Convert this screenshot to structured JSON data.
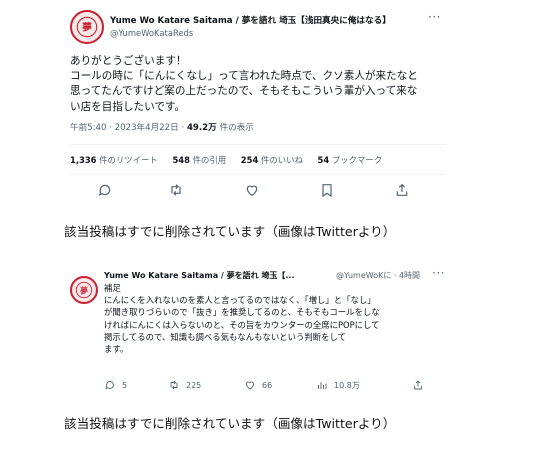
{
  "tweet1": {
    "display_name": "Yume Wo Katare Saitama / 夢を語れ 埼玉【浅田真央に俺はなる】",
    "handle": "@YumeWoKataReds",
    "more": "···",
    "body_lines": [
      "ありがとうございます！",
      "コールの時に「にんにくなし」って言われた時点で、クソ素人が来たなと",
      "思ってたんですけど案の上だったので、そもそもこういう輩が入って来な",
      "い店を目指したいです。"
    ],
    "meta_time": "午前5:40 · 2023年4月22日 · ",
    "meta_views_number": "49.2万",
    "meta_views_label": " 件の表示",
    "stats": {
      "retweets_count": "1,336",
      "retweets_label": " 件のリツイート",
      "quotes_count": "548",
      "quotes_label": " 件の引用",
      "likes_count": "254",
      "likes_label": " 件のいいね",
      "bookmarks_count": "54",
      "bookmarks_label": " ブックマーク"
    },
    "actions": [
      "reply-icon",
      "retweet-icon",
      "like-icon",
      "bookmark-icon",
      "share-icon"
    ]
  },
  "caption1": "該当投稿はすでに削除されています（画像はTwitterより）",
  "tweet2": {
    "display_name": "Yume Wo Katare Saitama / 夢を語れ 埼玉【...",
    "handle_time": "@YumeWoKに · 4時間",
    "more": "···",
    "body_lines": [
      "補足",
      "にんにくを入れないのを素人と言ってるのではなく、「増し」と「なし」",
      "が聞き取りづらいので「抜き」を推奨してるのと、そもそもコールをしな",
      "ければにんにくは入らないのと、その旨をカウンターの全席にPOPにして",
      "掲示してるので、知識も調べる気もなんもないという判断をして",
      "ます。"
    ],
    "actions": [
      {
        "icon": "reply-icon",
        "count": "5"
      },
      {
        "icon": "retweet-icon",
        "count": "225"
      },
      {
        "icon": "like-icon",
        "count": "66"
      },
      {
        "icon": "views-icon",
        "count": "10.8万"
      },
      {
        "icon": "share-icon",
        "count": ""
      }
    ]
  },
  "caption2": "該当投稿はすでに削除されています（画像はTwitterより）",
  "colors": {
    "text": "#0f1419",
    "secondary": "#536471",
    "divider": "#eff3f4",
    "avatar_red": "#c8202f"
  }
}
